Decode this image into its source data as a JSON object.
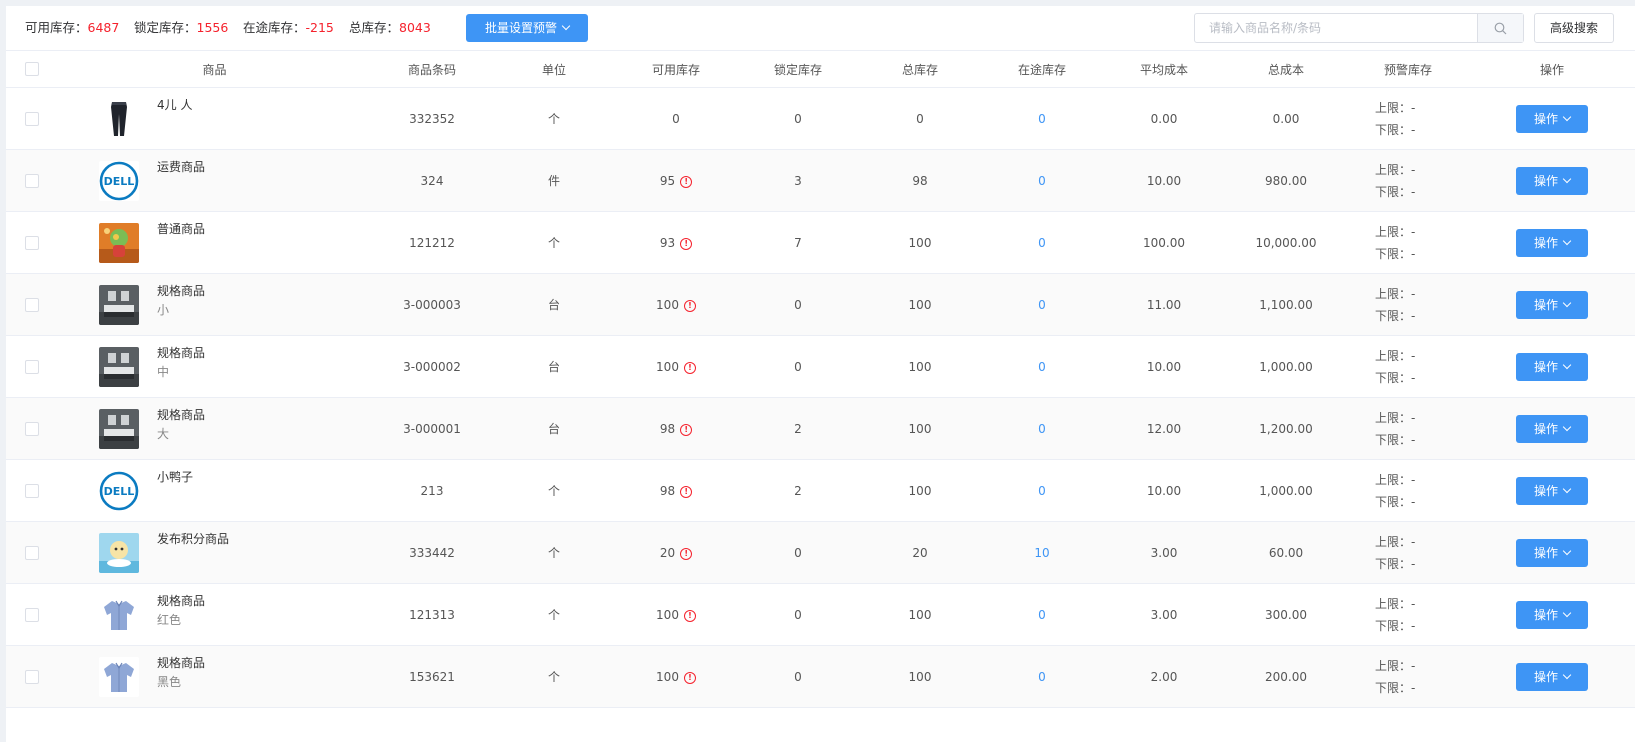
{
  "toolbar": {
    "stats": [
      {
        "label": "可用库存：",
        "value": "6487"
      },
      {
        "label": "锁定库存：",
        "value": "1556"
      },
      {
        "label": "在途库存：",
        "value": "-215"
      },
      {
        "label": "总库存：",
        "value": "8043"
      }
    ],
    "batch_button": "批量设置预警",
    "search_placeholder": "请输入商品名称/条码",
    "advanced_search": "高级搜索"
  },
  "table": {
    "columns": [
      "商品",
      "商品条码",
      "单位",
      "可用库存",
      "锁定库存",
      "总库存",
      "在途库存",
      "平均成本",
      "总成本",
      "预警库存",
      "操作"
    ],
    "upper_label": "上限：",
    "lower_label": "下限：",
    "action_label": "操作",
    "rows": [
      {
        "name": "4儿 人",
        "spec": "",
        "image": "trousers-image",
        "barcode": "332352",
        "unit": "个",
        "available": "0",
        "warn": false,
        "locked": "0",
        "total": "0",
        "transit": "0",
        "avg_cost": "0.00",
        "total_cost": "0.00",
        "upper": "-",
        "lower": "-"
      },
      {
        "name": "运费商品",
        "spec": "",
        "image": "dell-logo-image",
        "barcode": "324",
        "unit": "件",
        "available": "95",
        "warn": true,
        "locked": "3",
        "total": "98",
        "transit": "0",
        "avg_cost": "10.00",
        "total_cost": "980.00",
        "upper": "-",
        "lower": "-"
      },
      {
        "name": "普通商品",
        "spec": "",
        "image": "toy-figure-image",
        "barcode": "121212",
        "unit": "个",
        "available": "93",
        "warn": true,
        "locked": "7",
        "total": "100",
        "transit": "0",
        "avg_cost": "100.00",
        "total_cost": "10,000.00",
        "upper": "-",
        "lower": "-"
      },
      {
        "name": "规格商品",
        "spec": "小",
        "image": "bedroom-image",
        "barcode": "3-000003",
        "unit": "台",
        "available": "100",
        "warn": true,
        "locked": "0",
        "total": "100",
        "transit": "0",
        "avg_cost": "11.00",
        "total_cost": "1,100.00",
        "upper": "-",
        "lower": "-"
      },
      {
        "name": "规格商品",
        "spec": "中",
        "image": "bedroom-image",
        "barcode": "3-000002",
        "unit": "台",
        "available": "100",
        "warn": true,
        "locked": "0",
        "total": "100",
        "transit": "0",
        "avg_cost": "10.00",
        "total_cost": "1,000.00",
        "upper": "-",
        "lower": "-"
      },
      {
        "name": "规格商品",
        "spec": "大",
        "image": "bedroom-image",
        "barcode": "3-000001",
        "unit": "台",
        "available": "98",
        "warn": true,
        "locked": "2",
        "total": "100",
        "transit": "0",
        "avg_cost": "12.00",
        "total_cost": "1,200.00",
        "upper": "-",
        "lower": "-"
      },
      {
        "name": "小鸭子",
        "spec": "",
        "image": "dell-logo-image",
        "barcode": "213",
        "unit": "个",
        "available": "98",
        "warn": true,
        "locked": "2",
        "total": "100",
        "transit": "0",
        "avg_cost": "10.00",
        "total_cost": "1,000.00",
        "upper": "-",
        "lower": "-"
      },
      {
        "name": "发布积分商品",
        "spec": "",
        "image": "duck-toy-image",
        "barcode": "333442",
        "unit": "个",
        "available": "20",
        "warn": true,
        "locked": "0",
        "total": "20",
        "transit": "10",
        "avg_cost": "3.00",
        "total_cost": "60.00",
        "upper": "-",
        "lower": "-"
      },
      {
        "name": "规格商品",
        "spec": "红色",
        "image": "shirt-image",
        "barcode": "121313",
        "unit": "个",
        "available": "100",
        "warn": true,
        "locked": "0",
        "total": "100",
        "transit": "0",
        "avg_cost": "3.00",
        "total_cost": "300.00",
        "upper": "-",
        "lower": "-"
      },
      {
        "name": "规格商品",
        "spec": "黑色",
        "image": "shirt-image",
        "barcode": "153621",
        "unit": "个",
        "available": "100",
        "warn": true,
        "locked": "0",
        "total": "100",
        "transit": "0",
        "avg_cost": "2.00",
        "total_cost": "200.00",
        "upper": "-",
        "lower": "-"
      }
    ]
  },
  "colors": {
    "accent": "#3e95f5",
    "warning": "#f5222d"
  },
  "icons": {
    "search": "search-icon",
    "dropdown": "chevron-down-icon",
    "warning": "warning-icon"
  }
}
